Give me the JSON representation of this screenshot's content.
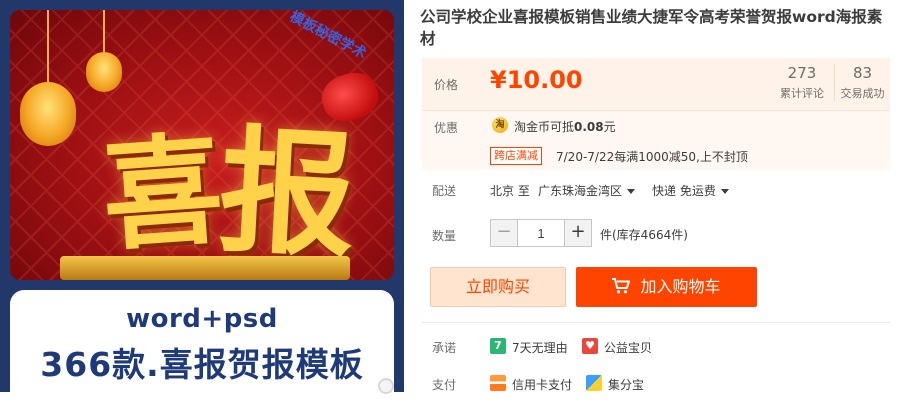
{
  "product_image": {
    "headline_char1": "喜",
    "headline_char2": "报",
    "watermark": "模板秘密学术",
    "line1": "word+psd",
    "line2": "366款.喜报贺报模板"
  },
  "title": "公司学校企业喜报模板销售业绩大捷军令高考荣誉贺报word海报素材",
  "price": {
    "label": "价格",
    "value": "¥10.00",
    "reviews_count": "273",
    "reviews_label": "累计评论",
    "sales_count": "83",
    "sales_label": "交易成功"
  },
  "promo": {
    "label": "优惠",
    "coin_icon_glyph": "淘",
    "coin_text_prefix": "淘金币可抵",
    "coin_amount": "0.08",
    "coin_text_suffix": "元",
    "tag": "跨店满减",
    "tag_text": "7/20-7/22每满1000减50,上不封顶"
  },
  "shipping": {
    "label": "配送",
    "origin": "北京 至",
    "destination": "广东珠海金湾区",
    "method": "快递 免运费"
  },
  "quantity": {
    "label": "数量",
    "minus": "−",
    "value": "1",
    "plus": "+",
    "stock": "件(库存4664件)"
  },
  "buttons": {
    "buy_now": "立即购买",
    "add_to_cart": "加入购物车"
  },
  "promise": {
    "label": "承诺",
    "item1_icon_glyph": "7",
    "item1": "7天无理由",
    "item2": "公益宝贝"
  },
  "payment": {
    "label": "支付",
    "item1": "信用卡支付",
    "item2": "集分宝"
  },
  "colors": {
    "accent": "#ff4400",
    "price_panel_bg": "#fff2e8",
    "image_frame": "#22386b",
    "image_text": "#1f3a78"
  }
}
